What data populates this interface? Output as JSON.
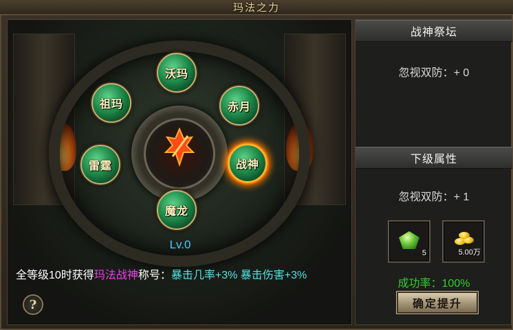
{
  "window": {
    "title": "玛法之力"
  },
  "orbs": {
    "top": "沃玛",
    "upper_left": "祖玛",
    "upper_right": "赤月",
    "left": "雷霆",
    "right": "战神",
    "bottom": "魔龙",
    "active": "战神"
  },
  "level": "Lv.0",
  "description": {
    "prefix": "全等级10时获得",
    "title_name": "玛法战神",
    "mid": "称号：",
    "bonus": "暴击几率+3% 暴击伤害+3%"
  },
  "help_label": "?",
  "current_panel": {
    "header": "战神祭坛",
    "stat": "忽视双防：+ 0"
  },
  "next_panel": {
    "header": "下级属性",
    "stat": "忽视双防：+ 1"
  },
  "costs": {
    "gem_count": "5",
    "gold_amount": "5.00万"
  },
  "success_rate": "成功率：100%",
  "confirm_button": "确定提升",
  "colors": {
    "level_text": "#49c9ff",
    "title_highlight": "#f23ef0",
    "bonus_text": "#4fe3e3",
    "success_rate": "#2fd02f",
    "title_gold": "#e8cf95"
  }
}
